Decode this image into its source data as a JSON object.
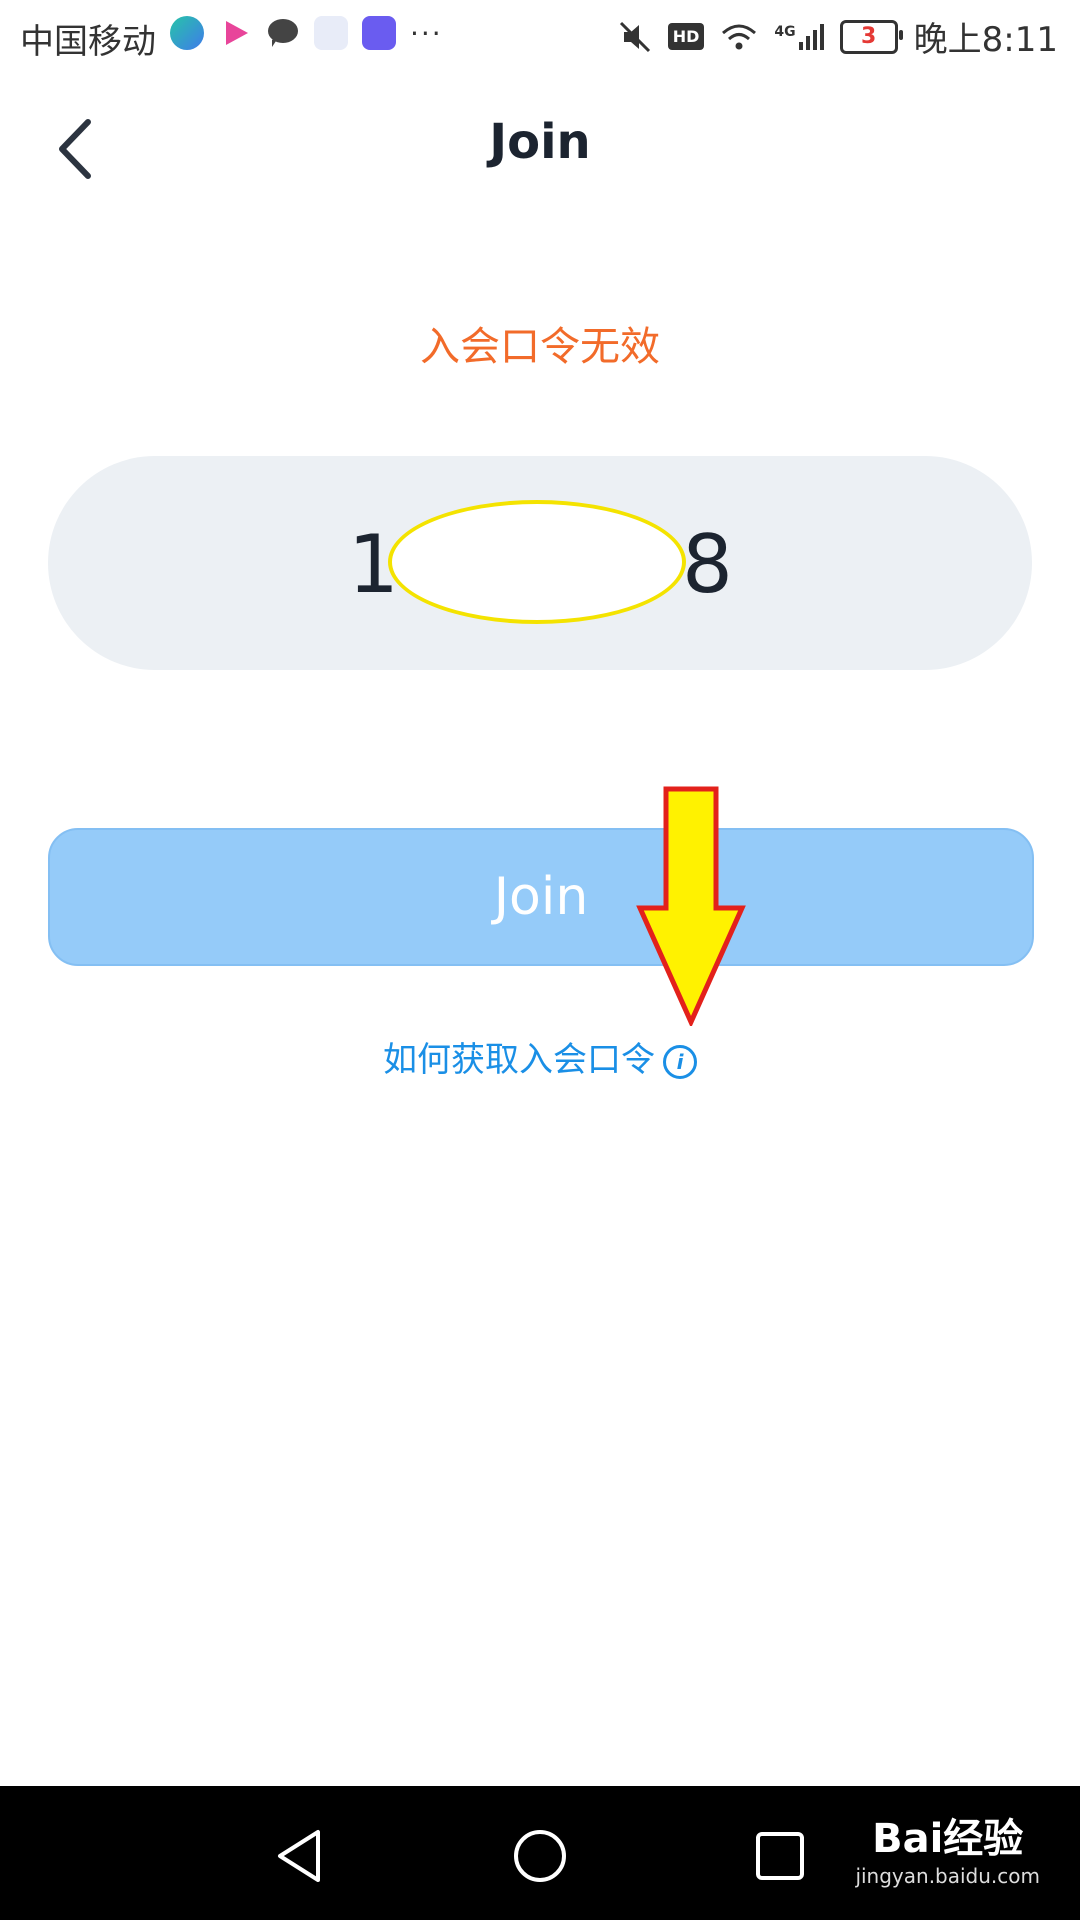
{
  "status_bar": {
    "carrier": "中国移动",
    "network": "4G",
    "battery": "3",
    "time": "晚上8:11",
    "hd": "HD",
    "more": "···"
  },
  "header": {
    "title": "Join",
    "back_icon": "chevron-left-icon"
  },
  "error_message": "入会口令无效",
  "code_field": {
    "visible_start": "1",
    "visible_end": "8"
  },
  "join_button": {
    "label": "Join"
  },
  "help_link": {
    "label": "如何获取入会口令",
    "icon": "info-icon"
  },
  "watermark": {
    "logo": "Bai经验",
    "site": "jingyan.baidu.com"
  },
  "colors": {
    "error": "#f26b2a",
    "button": "#95cbf9",
    "link": "#1a8fe6",
    "input_bg": "#ecf0f4"
  }
}
